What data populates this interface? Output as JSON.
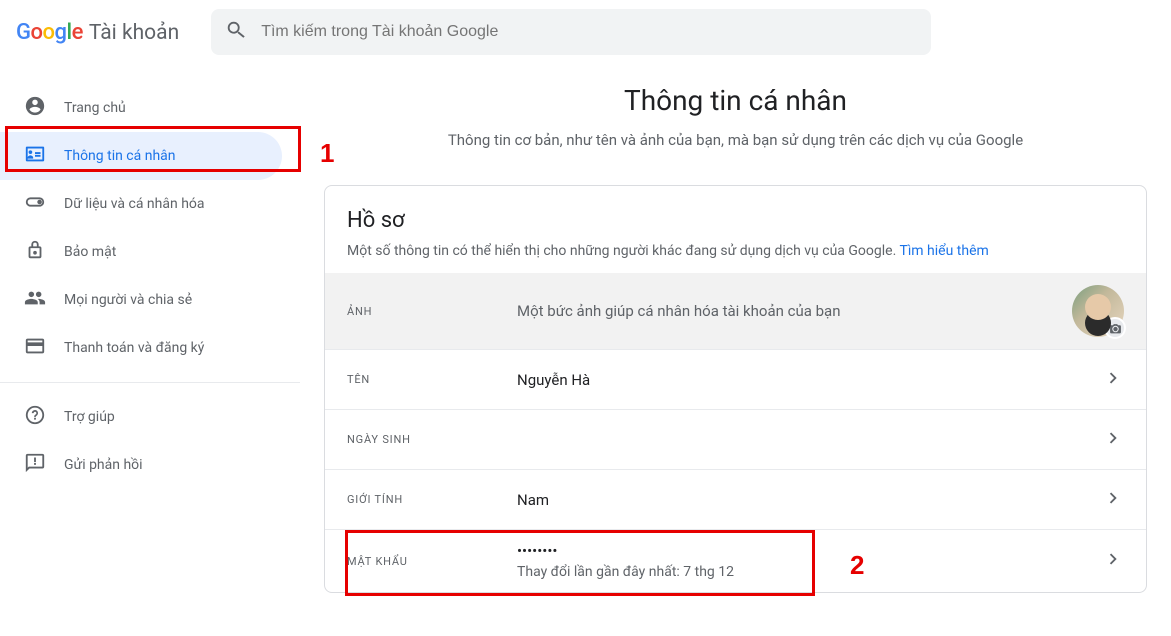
{
  "header": {
    "logo_product": "Tài khoản",
    "search_placeholder": "Tìm kiếm trong Tài khoản Google"
  },
  "sidebar": {
    "items": [
      {
        "label": "Trang chủ"
      },
      {
        "label": "Thông tin cá nhân"
      },
      {
        "label": "Dữ liệu và cá nhân hóa"
      },
      {
        "label": "Bảo mật"
      },
      {
        "label": "Mọi người và chia sẻ"
      },
      {
        "label": "Thanh toán và đăng ký"
      }
    ],
    "help_items": [
      {
        "label": "Trợ giúp"
      },
      {
        "label": "Gửi phản hồi"
      }
    ]
  },
  "page": {
    "title": "Thông tin cá nhân",
    "subtitle": "Thông tin cơ bản, như tên và ảnh của bạn, mà bạn sử dụng trên các dịch vụ của Google"
  },
  "profile_card": {
    "title": "Hồ sơ",
    "desc": "Một số thông tin có thể hiển thị cho những người khác đang sử dụng dịch vụ của Google.",
    "learn_more": "Tìm hiểu thêm",
    "rows": {
      "photo": {
        "label": "ẢNH",
        "desc": "Một bức ảnh giúp cá nhân hóa tài khoản của bạn"
      },
      "name": {
        "label": "TÊN",
        "value": "Nguyễn Hà"
      },
      "birthday": {
        "label": "NGÀY SINH",
        "value": ""
      },
      "gender": {
        "label": "GIỚI TÍNH",
        "value": "Nam"
      },
      "password": {
        "label": "MẬT KHẨU",
        "value": "••••••••",
        "sub": "Thay đổi lần gần đây nhất: 7 thg 12"
      }
    }
  },
  "annotations": {
    "a1": "1",
    "a2": "2"
  }
}
